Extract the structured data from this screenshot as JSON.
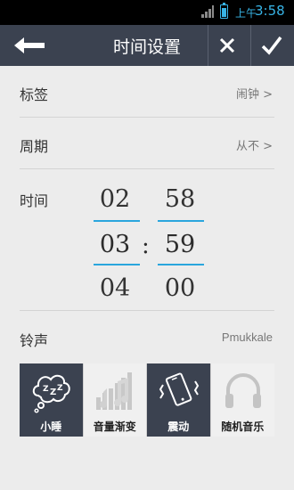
{
  "status_bar": {
    "time_prefix": "上午",
    "time": "3:58",
    "signal_icon": "signal-icon",
    "battery_icon": "battery-icon"
  },
  "header": {
    "title": "时间设置",
    "back_icon": "arrow-left-icon",
    "close_icon": "close-icon",
    "confirm_icon": "check-icon"
  },
  "settings": {
    "label": {
      "name": "标签",
      "value": "闹钟 >"
    },
    "repeat": {
      "name": "周期",
      "value": "从不 >"
    }
  },
  "time_picker": {
    "label": "时间",
    "separator": ":",
    "hours": {
      "prev": "02",
      "selected": "03",
      "next": "04"
    },
    "minutes": {
      "prev": "58",
      "selected": "59",
      "next": "00"
    },
    "accent_color": "#2aa6dd"
  },
  "ringtone": {
    "label": "铃声",
    "value": "Pmukkale"
  },
  "modes": [
    {
      "label": "小睡",
      "icon": "snooze-icon",
      "active": true
    },
    {
      "label": "音量渐变",
      "icon": "volume-rise-icon",
      "active": false
    },
    {
      "label": "震动",
      "icon": "vibrate-icon",
      "active": true
    },
    {
      "label": "随机音乐",
      "icon": "headphones-icon",
      "active": false
    }
  ],
  "colors": {
    "bar": "#3b4250",
    "background": "#ececec"
  }
}
